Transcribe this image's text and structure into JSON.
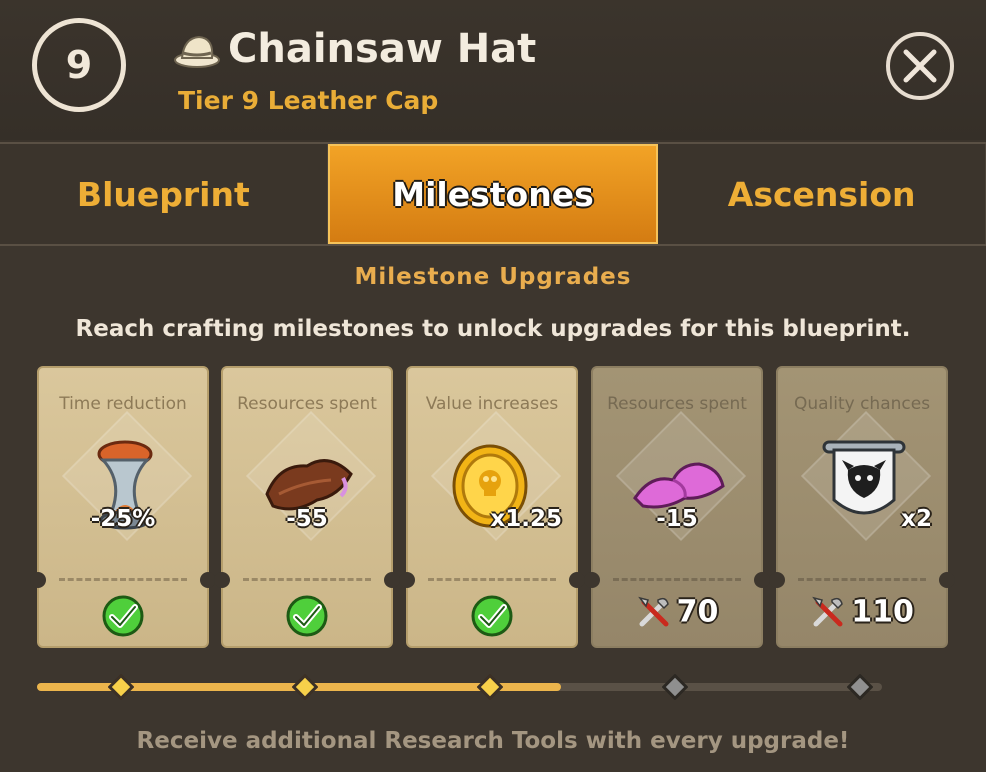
{
  "header": {
    "level": "9",
    "title": "Chainsaw Hat",
    "subtitle": "Tier 9 Leather Cap",
    "icon": "pith-helmet-icon"
  },
  "tabs": [
    {
      "label": "Blueprint",
      "active": false
    },
    {
      "label": "Milestones",
      "active": true
    },
    {
      "label": "Ascension",
      "active": false
    }
  ],
  "section": {
    "title": "Milestone Upgrades",
    "description": "Reach crafting milestones to unlock upgrades for this blueprint."
  },
  "milestones": [
    {
      "label": "Time reduction",
      "value": "-25%",
      "icon": "hourglass-icon",
      "unlocked": true
    },
    {
      "label": "Resources spent",
      "value": "-55",
      "icon": "leather-icon",
      "unlocked": true
    },
    {
      "label": "Value increases",
      "value": "x1.25",
      "icon": "gold-coin-icon",
      "unlocked": true
    },
    {
      "label": "Resources spent",
      "value": "-15",
      "icon": "pink-cloth-icon",
      "unlocked": false,
      "cost": "70"
    },
    {
      "label": "Quality chances",
      "value": "x2",
      "icon": "demon-banner-icon",
      "unlocked": false,
      "cost": "110"
    }
  ],
  "progress": {
    "fraction": 0.62,
    "reached": 3,
    "total": 5
  },
  "footer": "Receive additional Research Tools with every upgrade!",
  "colors": {
    "accent": "#eeae36",
    "activeTab": "#e48f1c",
    "cardUnlocked": "#d6c397",
    "cardLocked": "#9c8e70"
  }
}
